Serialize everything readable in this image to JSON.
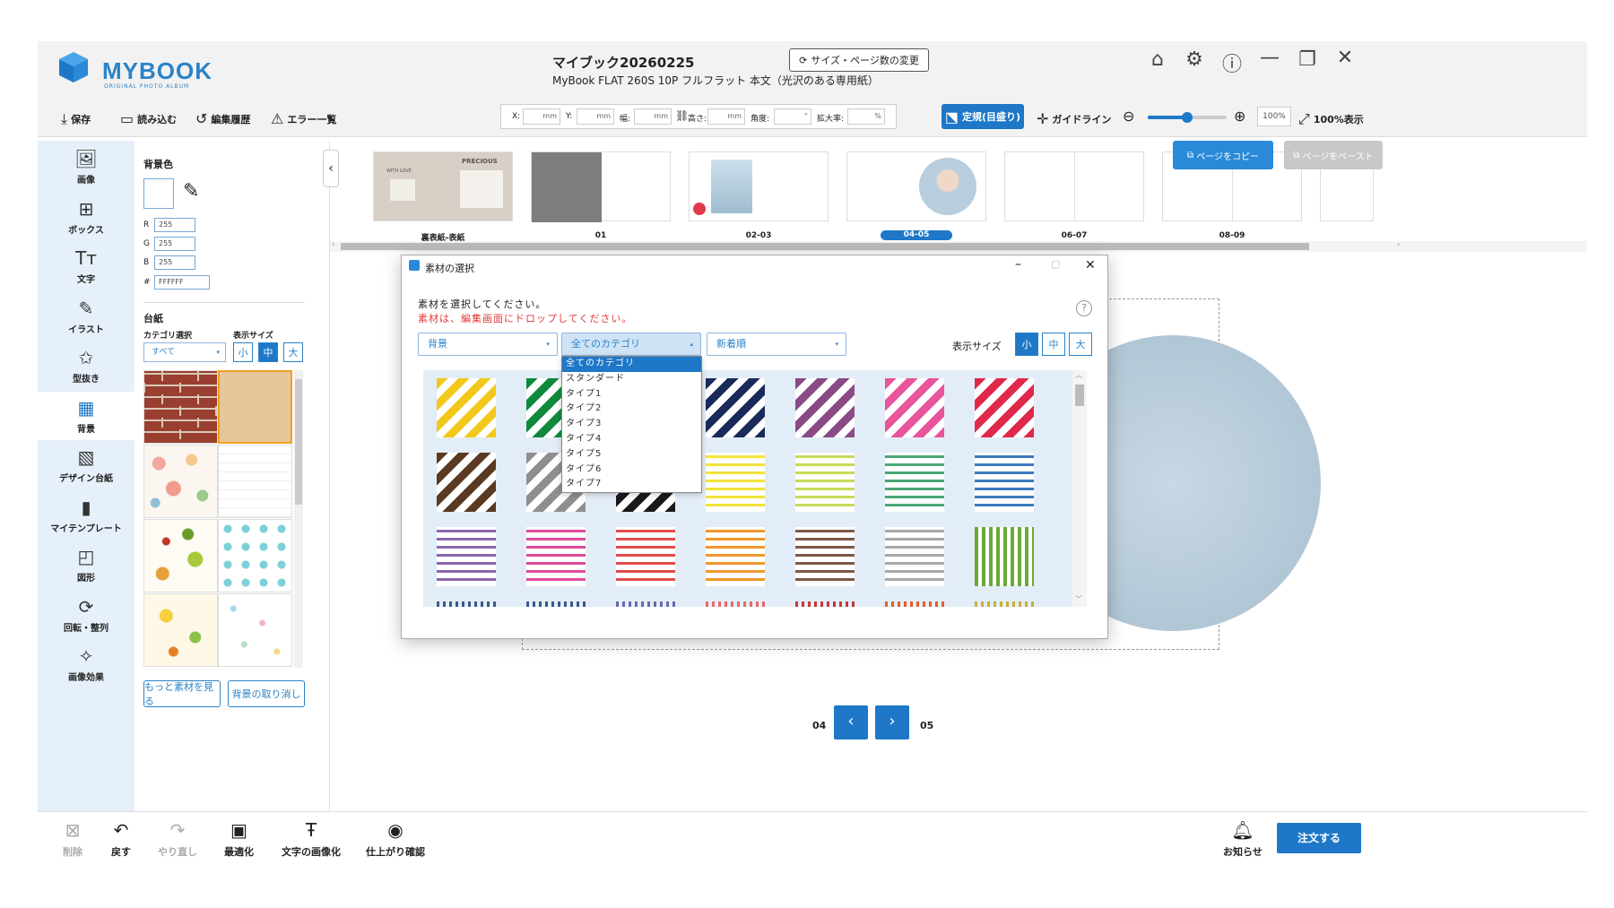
{
  "app": {
    "logo_text": "MYBOOK",
    "logo_sub": "ORIGINAL PHOTO ALBUM",
    "title": "マイブック20260225",
    "subtitle": "MyBook FLAT 260S 10P フルフラット 本文（光沢のある専用紙）",
    "size_change_label": "サイズ・ページ数の変更",
    "window_icons": [
      "home-icon",
      "gear-icon",
      "help-icon",
      "minimize-icon",
      "restore-icon",
      "close-icon"
    ]
  },
  "toolbar": {
    "save": "保存",
    "load": "読み込む",
    "history": "編集履歴",
    "errors": "エラー一覧",
    "fields": [
      {
        "label": "X:",
        "unit": "mm"
      },
      {
        "label": "Y:",
        "unit": "mm"
      },
      {
        "label": "幅:",
        "unit": "mm"
      },
      {
        "label": "高さ:",
        "unit": "mm"
      },
      {
        "label": "角度:",
        "unit": "°"
      },
      {
        "label": "拡大率:",
        "unit": "%"
      }
    ],
    "ruler_btn": "定規(目盛り)",
    "guideline": "ガイドライン",
    "zoom_value": "100%",
    "zoom_level": 0.5,
    "fit_label": "100%表示"
  },
  "sidebar": {
    "items": [
      {
        "label": "画像",
        "icon": "image-add-icon"
      },
      {
        "label": "ボックス",
        "icon": "box-layout-icon"
      },
      {
        "label": "文字",
        "icon": "text-icon"
      },
      {
        "label": "イラスト",
        "icon": "brush-icon"
      },
      {
        "label": "型抜き",
        "icon": "star-cut-icon"
      },
      {
        "label": "背景",
        "icon": "checker-icon"
      },
      {
        "label": "デザイン台紙",
        "icon": "pen-frame-icon"
      },
      {
        "label": "マイテンプレート",
        "icon": "template-icon"
      },
      {
        "label": "図形",
        "icon": "shapes-icon"
      },
      {
        "label": "回転・整列",
        "icon": "rotate-icon"
      },
      {
        "label": "画像効果",
        "icon": "magic-wand-icon"
      }
    ],
    "active_index": 5
  },
  "panel": {
    "bg_color_label": "背景色",
    "r": "255",
    "g": "255",
    "b": "255",
    "hex": "FFFFFF",
    "r_label": "R",
    "g_label": "G",
    "b_label": "B",
    "hex_label": "#",
    "daishi_label": "台紙",
    "category_label": "カテゴリ選択",
    "size_label": "表示サイズ",
    "category_value": "すべて",
    "sizes": [
      "小",
      "中",
      "大"
    ],
    "active_size": 1,
    "more_btn": "もっと素材を見る",
    "cancel_bg_btn": "背景の取り消し"
  },
  "pages": {
    "thumbs": [
      {
        "label": "裏表紙-表紙",
        "cover_text_1": "PRECIOUS",
        "cover_text_2": "WITH LOVE"
      },
      {
        "label": "01"
      },
      {
        "label": "02-03"
      },
      {
        "label": "04-05",
        "active": true
      },
      {
        "label": "06-07"
      },
      {
        "label": "08-09"
      }
    ],
    "copy_btn": "ページをコピー",
    "paste_btn": "ページをペースト",
    "nav_left": "04",
    "nav_right": "05"
  },
  "dialog": {
    "title": "素材の選択",
    "instruction": "素材を選択してください。",
    "note": "素材は、編集画面にドロップしてください。",
    "select_type": "背景",
    "select_category": "全てのカテゴリ",
    "select_sort": "新着順",
    "size_label": "表示サイズ",
    "sizes": [
      "小",
      "中",
      "大"
    ],
    "active_size": 0,
    "dropdown_options": [
      "全てのカテゴリ",
      "スタンダード",
      "タイプ1",
      "タイプ2",
      "タイプ3",
      "タイプ4",
      "タイプ5",
      "タイプ6",
      "タイプ7"
    ],
    "dropdown_selected": 0,
    "swatch_colors_row1": [
      "#f2c81a",
      "#0f8a3c",
      "#d9d9d9",
      "#1a2a5a",
      "#8a4a86",
      "#e8559a",
      "#e0294a"
    ],
    "swatch_colors_row2": [
      "#5a3a22",
      "#8f8f8f",
      "#1a1a1a",
      "#f2e23a",
      "#c8d95a",
      "#4aa878",
      "#3a7cc0"
    ],
    "swatch_colors_row3": [
      "#8a64a8",
      "#e04a9a",
      "#e04a4a",
      "#f0962a",
      "#7a5a46",
      "#a8a8a8",
      "#6aa83a"
    ],
    "swatch_colors_row4": [
      "#3a5a8a",
      "#3a5a8a",
      "#6a6aa8",
      "#e86a6a",
      "#c03a3a",
      "#e0602a",
      "#c8b03a"
    ]
  },
  "bottom": {
    "delete": "削除",
    "undo": "戻す",
    "redo": "やり直し",
    "optimize": "最適化",
    "text_to_image": "文字の画像化",
    "preview": "仕上がり確認",
    "notice": "お知らせ",
    "order": "注文する"
  },
  "colors": {
    "accent": "#1e77c7",
    "sidebar_bg": "#e6f0fa",
    "note_red": "#e03a3a"
  }
}
